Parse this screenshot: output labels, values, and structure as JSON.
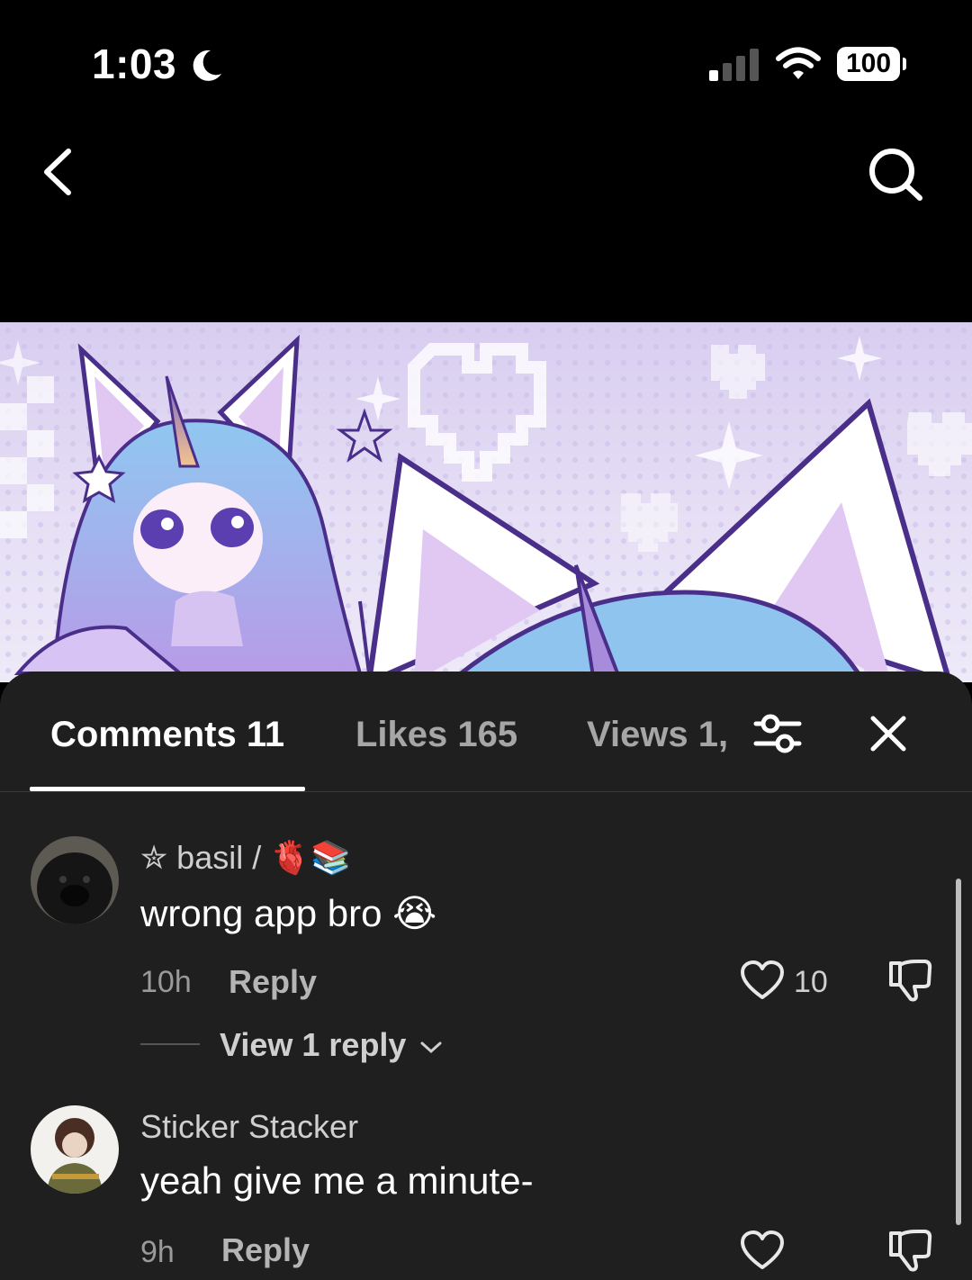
{
  "status_bar": {
    "time": "1:03",
    "battery": "100"
  },
  "tabs": {
    "comments": "Comments 11",
    "likes": "Likes 165",
    "views": "Views 1,"
  },
  "comments": [
    {
      "username": "✮ basil / 🫀📚",
      "text": "wrong app bro 😭",
      "time": "10h",
      "reply_label": "Reply",
      "likes": "10",
      "view_replies": "View 1 reply"
    },
    {
      "username": "Sticker Stacker",
      "text": "yeah give me a minute-",
      "time": "9h",
      "reply_label": "Reply",
      "likes": ""
    }
  ],
  "colors": {
    "sheet_bg": "#1f1f1f",
    "artwork_accent": "#b9a3ea"
  },
  "icons": [
    "moon-icon",
    "signal-icon",
    "wifi-icon",
    "back-icon",
    "search-icon",
    "filter-icon",
    "close-icon",
    "heart-icon",
    "dislike-icon",
    "chevron-down-icon"
  ]
}
